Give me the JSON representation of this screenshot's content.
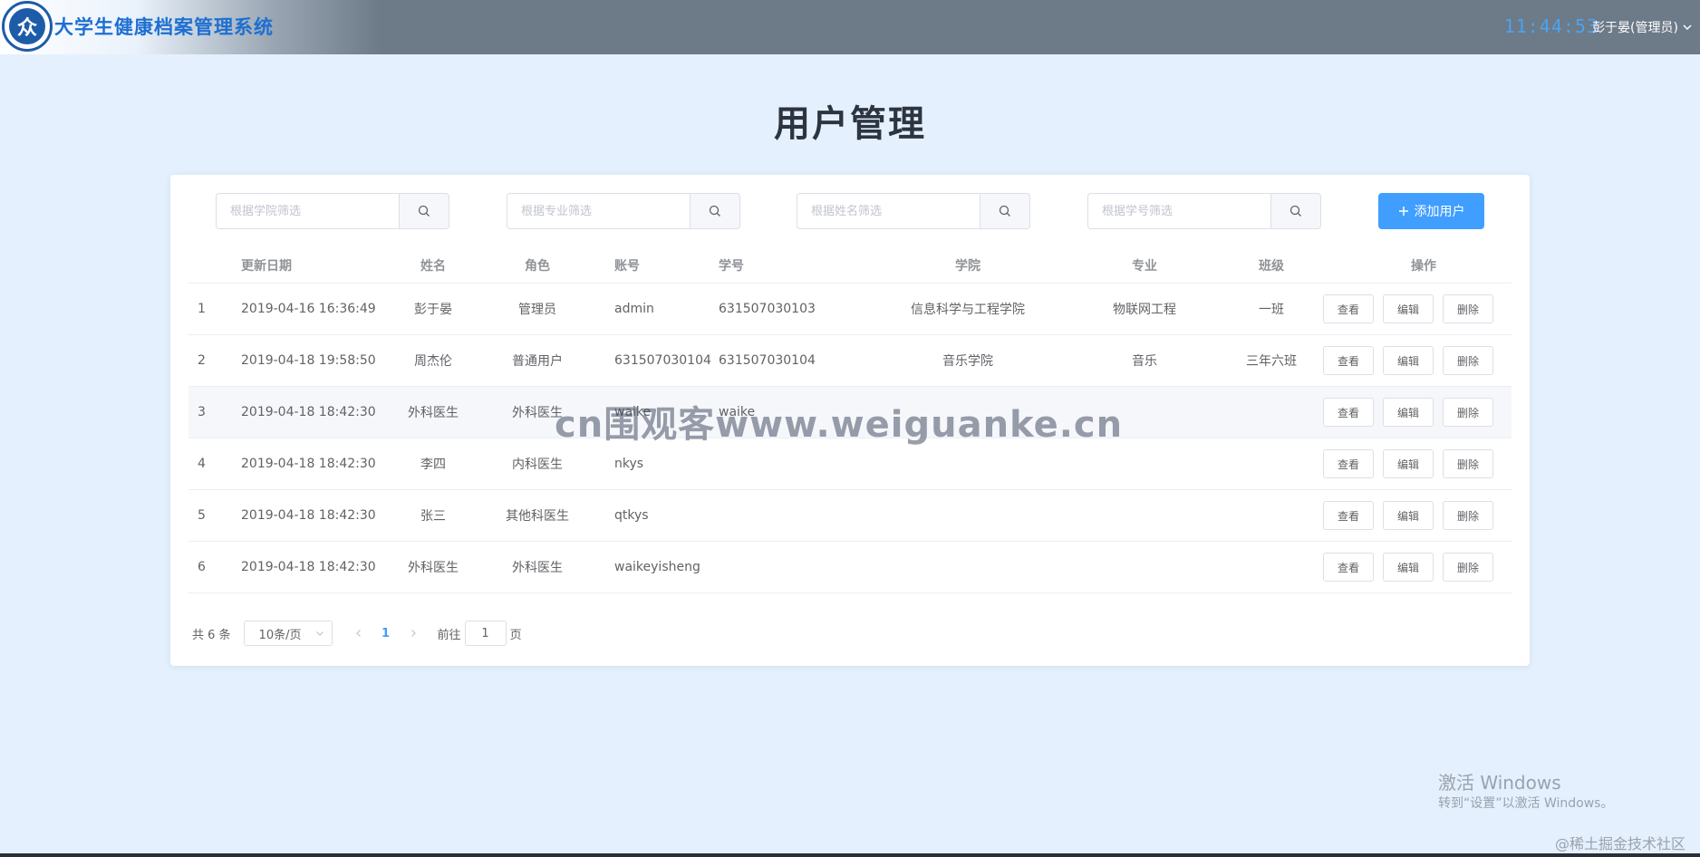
{
  "header": {
    "app_title": "大学生健康档案管理系统",
    "clock": "11:44:53",
    "user": "彭于晏(管理员)",
    "logo_glyph": "众"
  },
  "page_title": "用户管理",
  "filters": [
    {
      "placeholder": "根据学院筛选"
    },
    {
      "placeholder": "根据专业筛选"
    },
    {
      "placeholder": "根据姓名筛选"
    },
    {
      "placeholder": "根据学号筛选"
    }
  ],
  "add_button": {
    "icon": "plus-icon",
    "label": "添加用户"
  },
  "table": {
    "columns": {
      "index": "",
      "date": "更新日期",
      "name": "姓名",
      "role": "角色",
      "account": "账号",
      "student_no": "学号",
      "college": "学院",
      "major": "专业",
      "class": "班级",
      "ops": "操作"
    },
    "op_labels": {
      "view": "查看",
      "edit": "编辑",
      "delete": "删除"
    },
    "rows": [
      {
        "index": "1",
        "date": "2019-04-16 16:36:49",
        "name": "彭于晏",
        "role": "管理员",
        "account": "admin",
        "student_no": "631507030103",
        "college": "信息科学与工程学院",
        "major": "物联网工程",
        "class": "一班"
      },
      {
        "index": "2",
        "date": "2019-04-18 19:58:50",
        "name": "周杰伦",
        "role": "普通用户",
        "account": "631507030104",
        "student_no": "631507030104",
        "college": "音乐学院",
        "major": "音乐",
        "class": "三年六班"
      },
      {
        "index": "3",
        "date": "2019-04-18 18:42:30",
        "name": "外科医生",
        "role": "外科医生",
        "account": "waike",
        "student_no": "waike",
        "college": "",
        "major": "",
        "class": ""
      },
      {
        "index": "4",
        "date": "2019-04-18 18:42:30",
        "name": "李四",
        "role": "内科医生",
        "account": "nkys",
        "student_no": "",
        "college": "",
        "major": "",
        "class": ""
      },
      {
        "index": "5",
        "date": "2019-04-18 18:42:30",
        "name": "张三",
        "role": "其他科医生",
        "account": "qtkys",
        "student_no": "",
        "college": "",
        "major": "",
        "class": ""
      },
      {
        "index": "6",
        "date": "2019-04-18 18:42:30",
        "name": "外科医生",
        "role": "外科医生",
        "account": "waikeyisheng",
        "student_no": "",
        "college": "",
        "major": "",
        "class": ""
      }
    ]
  },
  "pagination": {
    "total": "共 6 条",
    "page_size": "10条/页",
    "current_page": "1",
    "goto_label": "前往",
    "goto_value": "1",
    "page_suffix": "页"
  },
  "watermarks": {
    "center": "cn围观客www.weiguanke.cn",
    "windows_line1": "激活 Windows",
    "windows_line2": "转到“设置”以激活 Windows。",
    "juejin": "@稀土掘金技术社区"
  }
}
